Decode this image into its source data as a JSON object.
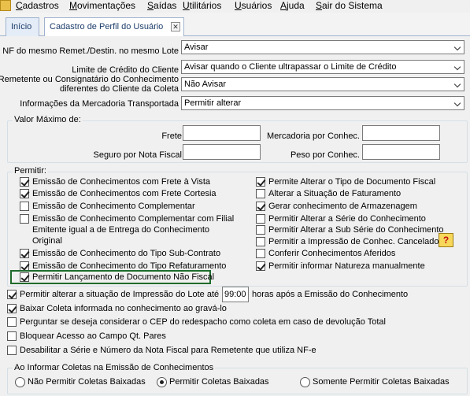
{
  "menu": {
    "items": [
      "Cadastros",
      "Movimentações",
      "Saídas",
      "Utilitários",
      "Usuários",
      "Ajuda",
      "Sair do Sistema"
    ]
  },
  "tabs": [
    {
      "label": "Início"
    },
    {
      "label": "Cadastro de Perfil do Usuário"
    }
  ],
  "fields": {
    "nf_mesmo_remet": {
      "label": "NF do mesmo Remet./Destin. no mesmo Lote",
      "value": "Avisar"
    },
    "limite_credito": {
      "label": "Limite de Crédito do Cliente",
      "value": "Avisar quando o Cliente ultrapassar o Limite de Crédito"
    },
    "remetente_consignatario": {
      "label_line1": "Remetente ou Consignatário do Conhecimento",
      "label_line2": "diferentes do Cliente da Coleta",
      "value": "Não Avisar"
    },
    "info_mercadoria": {
      "label": "Informações da Mercadoria Transportada",
      "value": "Permitir alterar"
    }
  },
  "valor_maximo": {
    "title": "Valor Máximo de:",
    "frete": "Frete",
    "mercadoria": "Mercadoria por Conhec.",
    "seguro": "Seguro por Nota Fiscal",
    "peso": "Peso por Conhec."
  },
  "permitir": {
    "title": "Permitir:",
    "left": [
      {
        "label": "Emissão de Conhecimentos com Frete à Vista",
        "checked": true
      },
      {
        "label": "Emissão de Conhecimentos com Frete Cortesia",
        "checked": true
      },
      {
        "label": "Emissão de Conhecimento Complementar",
        "checked": false
      },
      {
        "label": "Emissão de Conhecimento Complementar com Filial",
        "line2": "Emitente igual a de Entrega do Conhecimento",
        "line3": "Original",
        "checked": false
      },
      {
        "label": "Emissão de Conhecimento do Tipo Sub-Contrato",
        "checked": true
      },
      {
        "label": "Emissão de Conhecimento  do Tipo Refaturamento",
        "checked": true
      },
      {
        "label": "Permitir Lançamento de Documento Não Fiscal",
        "checked": true
      }
    ],
    "right": [
      {
        "label": "Permite Alterar o Tipo de Documento Fiscal",
        "checked": true
      },
      {
        "label": "Alterar a Situação de Faturamento",
        "checked": false
      },
      {
        "label": "Gerar conhecimento de Armazenagem",
        "checked": true
      },
      {
        "label": "Permitir Alterar a Série do Conhecimento",
        "checked": false
      },
      {
        "label": "Permitir Alterar a Sub Série do Conhecimento",
        "checked": false
      },
      {
        "label": "Permitir a Impressão de Conhec. Cancelado",
        "checked": false
      },
      {
        "label": "Conferir Conhecimentos Aferidos",
        "checked": false
      },
      {
        "label": "Permitir informar Natureza manualmente",
        "checked": true
      }
    ],
    "help_icon": "question-mark-icon"
  },
  "lower": {
    "alterar_situacao": {
      "label": "Permitir alterar a situação de Impressão do Lote até",
      "hours": "99:00",
      "suffix": "horas após a Emissão do Conhecimento",
      "checked": true
    },
    "baixar_coleta": {
      "label": "Baixar Coleta informada no conhecimento ao gravá-lo",
      "checked": true
    },
    "perguntar_cep": {
      "label": "Perguntar se deseja considerar o CEP do redespacho como coleta em caso de devolução Total",
      "checked": false
    },
    "bloquear_acesso": {
      "label": "Bloquear Acesso ao Campo Qt. Pares",
      "checked": false
    },
    "desabilitar_serie": {
      "label": "Desabilitar a Série e Número da Nota Fiscal para Remetente que utiliza NF-e",
      "checked": false
    }
  },
  "coletas": {
    "title": "Ao Informar Coletas na Emissão de Conhecimentos",
    "options": [
      {
        "label": "Não Permitir Coletas Baixadas",
        "selected": false
      },
      {
        "label": "Permitir Coletas Baixadas",
        "selected": true
      },
      {
        "label": "Somente Permitir Coletas Baixadas",
        "selected": false
      }
    ]
  },
  "colors": {
    "highlight_border": "#1f6b2c",
    "help_bg": "#f8d85a"
  }
}
